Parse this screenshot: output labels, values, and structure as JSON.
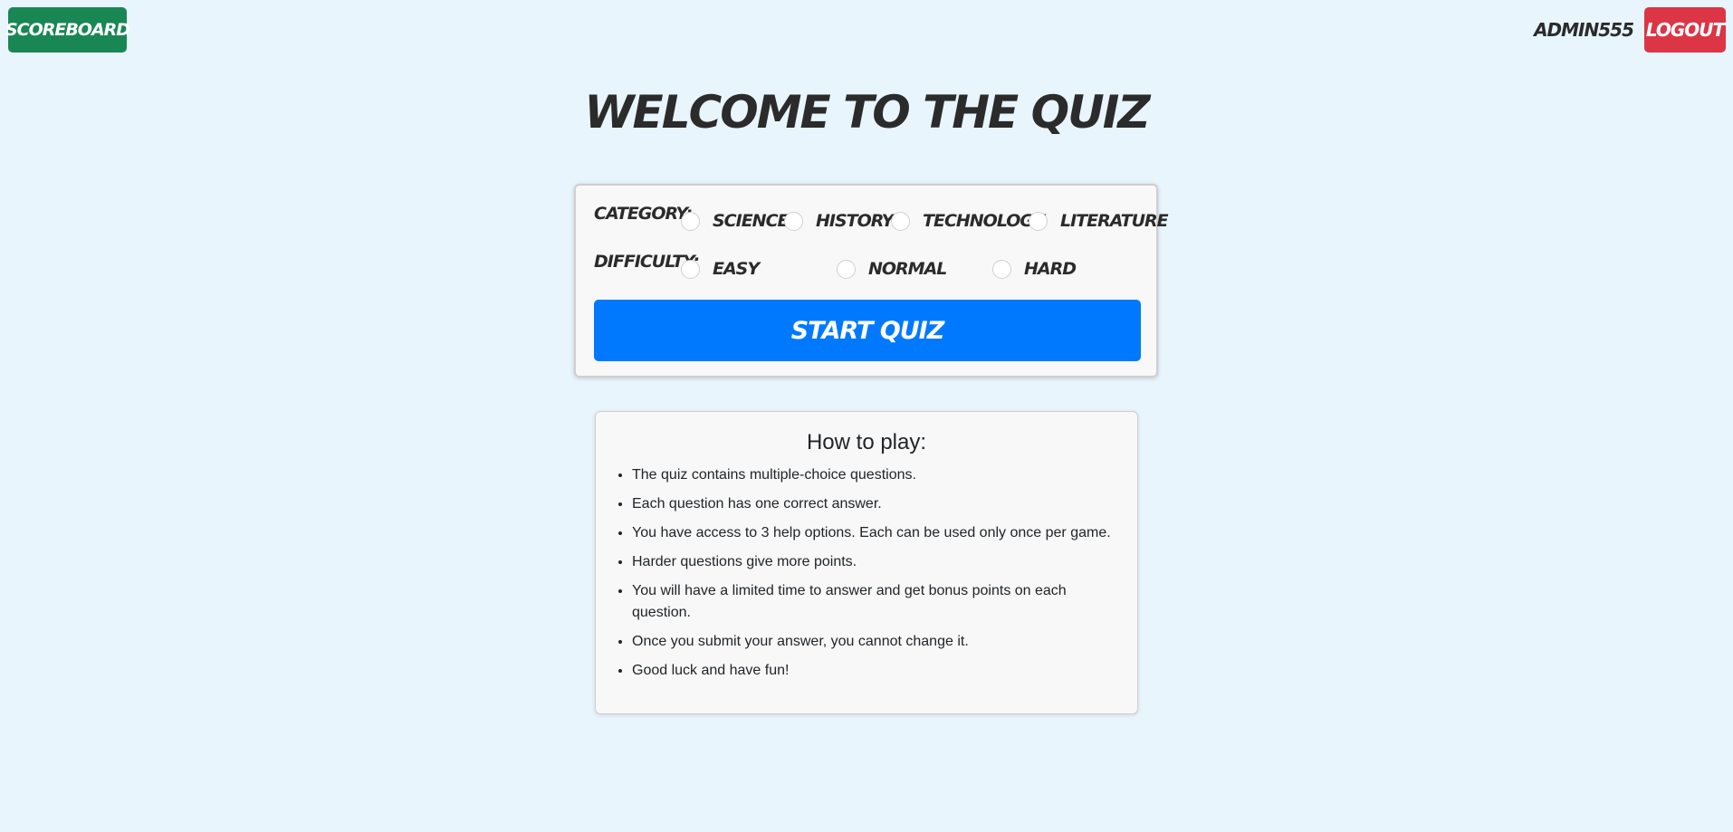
{
  "header": {
    "scoreboard_label": "SCOREBOARD",
    "username": "ADMIN555",
    "logout_label": "LOGOUT"
  },
  "page_title": "WELCOME TO THE QUIZ",
  "settings": {
    "category_label": "CATEGORY:",
    "categories": [
      "SCIENCE",
      "HISTORY",
      "TECHNOLOGY",
      "LITERATURE"
    ],
    "difficulty_label": "DIFFICULTY:",
    "difficulties": [
      "EASY",
      "NORMAL",
      "HARD"
    ],
    "start_label": "START QUIZ"
  },
  "howto": {
    "title": "How to play:",
    "rules": [
      "The quiz contains multiple-choice questions.",
      "Each question has one correct answer.",
      "You have access to 3 help options. Each can be used only once per game.",
      "Harder questions give more points.",
      "You will have a limited time to answer and get bonus points on each question.",
      "Once you submit your answer, you cannot change it.",
      "Good luck and have fun!"
    ]
  },
  "colors": {
    "background": "#e8f5fc",
    "scoreboard": "#198754",
    "logout": "#dc3545",
    "start": "#0079ff"
  }
}
